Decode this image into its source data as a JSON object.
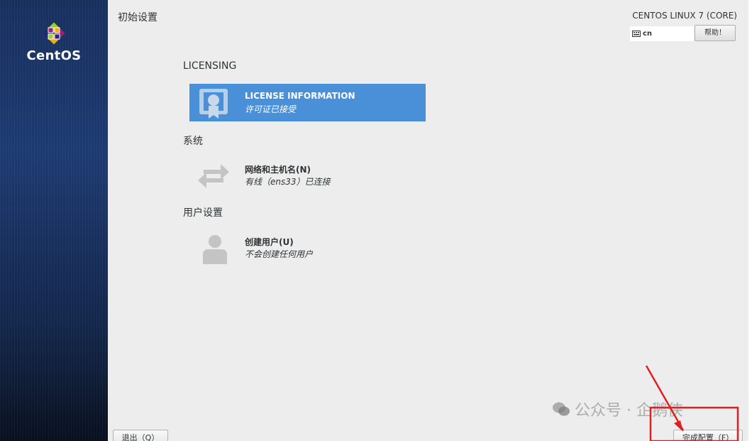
{
  "sidebar": {
    "brand": "CentOS",
    "logo_icon": "centos-logo-icon"
  },
  "header": {
    "title": "初始设置",
    "product": "CENTOS LINUX 7 (CORE)",
    "keyboard_layout": "cn",
    "keyboard_icon": "keyboard-icon",
    "help_label": "帮助！"
  },
  "sections": [
    {
      "heading": "LICENSING",
      "spokes": [
        {
          "title": "LICENSE INFORMATION",
          "status": "许可证已接受",
          "icon": "license-icon",
          "selected": true
        }
      ]
    },
    {
      "heading": "系统",
      "spokes": [
        {
          "title": "网络和主机名(N)",
          "status": "有线（ens33）已连接",
          "icon": "network-arrows-icon",
          "selected": false
        }
      ]
    },
    {
      "heading": "用户设置",
      "spokes": [
        {
          "title": "创建用户(U)",
          "status": "不会创建任何用户",
          "icon": "user-icon",
          "selected": false
        }
      ]
    }
  ],
  "footer": {
    "quit_label": "退出（Q）",
    "finish_label": "完成配置（F）"
  },
  "watermark": {
    "text": "公众号 · 企鹅侠",
    "icon": "wechat-icon"
  },
  "colors": {
    "sidebar": "#1d3a72",
    "selected_spoke": "#4a90d9",
    "annotation": "#e02020",
    "panel": "#ededed"
  }
}
